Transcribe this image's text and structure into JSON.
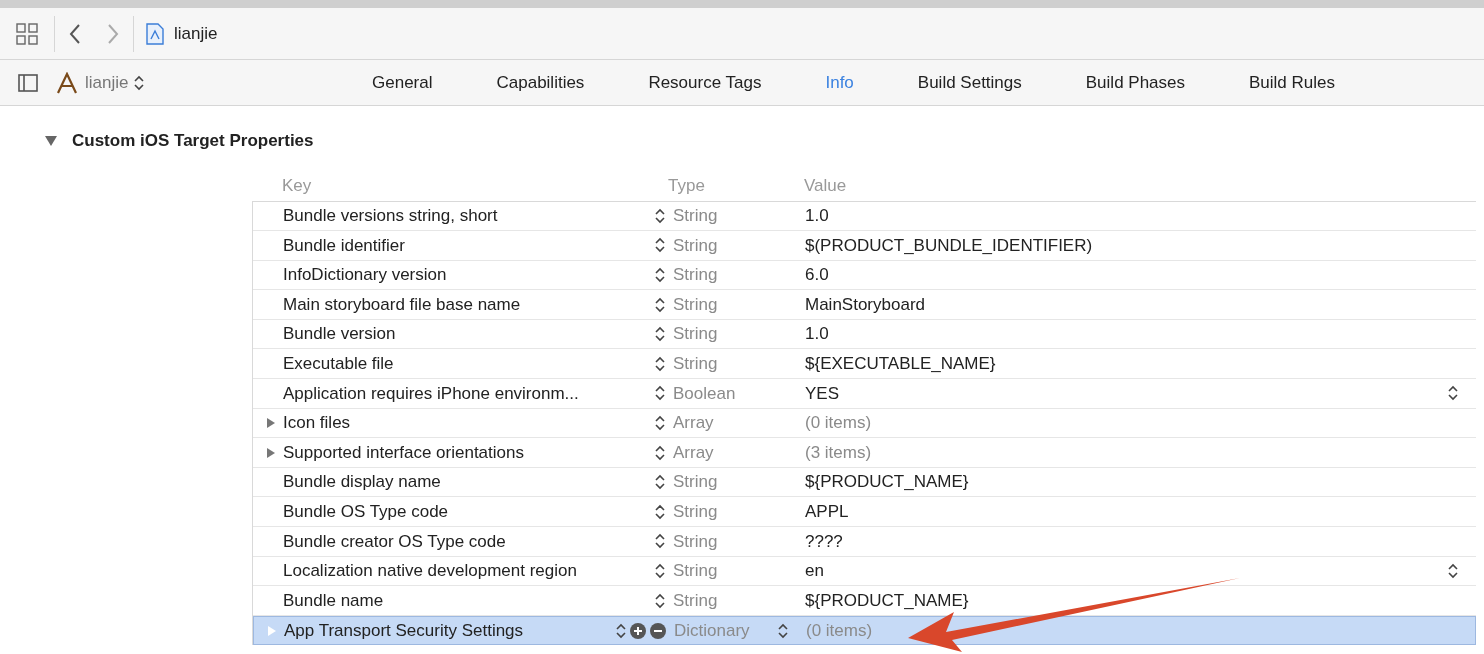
{
  "breadcrumb": {
    "file": "lianjie"
  },
  "target": {
    "name": "lianjie"
  },
  "tabs": [
    {
      "label": "General",
      "selected": false
    },
    {
      "label": "Capabilities",
      "selected": false
    },
    {
      "label": "Resource Tags",
      "selected": false
    },
    {
      "label": "Info",
      "selected": true
    },
    {
      "label": "Build Settings",
      "selected": false
    },
    {
      "label": "Build Phases",
      "selected": false
    },
    {
      "label": "Build Rules",
      "selected": false
    }
  ],
  "section": {
    "title": "Custom iOS Target Properties",
    "expanded": true
  },
  "table": {
    "columns": [
      "Key",
      "Type",
      "Value"
    ],
    "rows": [
      {
        "key": "Bundle versions string, short",
        "type": "String",
        "value": "1.0",
        "expandable": false,
        "muted_value": false,
        "value_popup": false,
        "selected": false
      },
      {
        "key": "Bundle identifier",
        "type": "String",
        "value": "$(PRODUCT_BUNDLE_IDENTIFIER)",
        "expandable": false,
        "muted_value": false,
        "value_popup": false,
        "selected": false
      },
      {
        "key": "InfoDictionary version",
        "type": "String",
        "value": "6.0",
        "expandable": false,
        "muted_value": false,
        "value_popup": false,
        "selected": false
      },
      {
        "key": "Main storyboard file base name",
        "type": "String",
        "value": "MainStoryboard",
        "expandable": false,
        "muted_value": false,
        "value_popup": false,
        "selected": false
      },
      {
        "key": "Bundle version",
        "type": "String",
        "value": "1.0",
        "expandable": false,
        "muted_value": false,
        "value_popup": false,
        "selected": false
      },
      {
        "key": "Executable file",
        "type": "String",
        "value": "${EXECUTABLE_NAME}",
        "expandable": false,
        "muted_value": false,
        "value_popup": false,
        "selected": false
      },
      {
        "key": "Application requires iPhone environm...",
        "type": "Boolean",
        "value": "YES",
        "expandable": false,
        "muted_value": false,
        "value_popup": true,
        "selected": false
      },
      {
        "key": "Icon files",
        "type": "Array",
        "value": "(0 items)",
        "expandable": true,
        "muted_value": true,
        "value_popup": false,
        "selected": false
      },
      {
        "key": "Supported interface orientations",
        "type": "Array",
        "value": "(3 items)",
        "expandable": true,
        "muted_value": true,
        "value_popup": false,
        "selected": false
      },
      {
        "key": "Bundle display name",
        "type": "String",
        "value": "${PRODUCT_NAME}",
        "expandable": false,
        "muted_value": false,
        "value_popup": false,
        "selected": false
      },
      {
        "key": "Bundle OS Type code",
        "type": "String",
        "value": "APPL",
        "expandable": false,
        "muted_value": false,
        "value_popup": false,
        "selected": false
      },
      {
        "key": "Bundle creator OS Type code",
        "type": "String",
        "value": "????",
        "expandable": false,
        "muted_value": false,
        "value_popup": false,
        "selected": false
      },
      {
        "key": "Localization native development region",
        "type": "String",
        "value": "en",
        "expandable": false,
        "muted_value": false,
        "value_popup": true,
        "selected": false
      },
      {
        "key": "Bundle name",
        "type": "String",
        "value": "${PRODUCT_NAME}",
        "expandable": false,
        "muted_value": false,
        "value_popup": false,
        "selected": false
      },
      {
        "key": "App Transport Security Settings",
        "type": "Dictionary",
        "value": "(0 items)",
        "expandable": true,
        "muted_value": true,
        "value_popup": false,
        "selected": true
      }
    ]
  }
}
